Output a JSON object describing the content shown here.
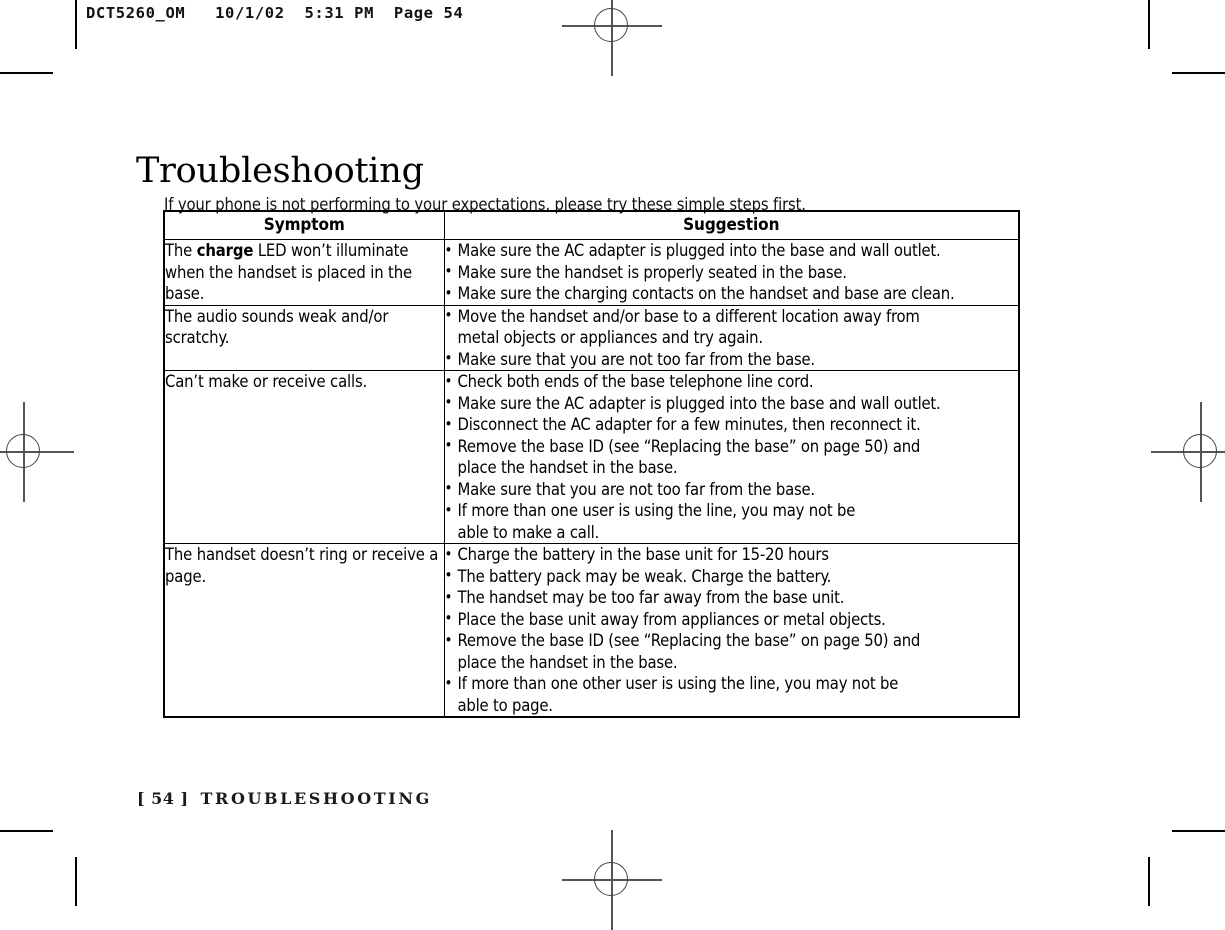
{
  "slug": "DCT5260_OM   10/1/02  5:31 PM  Page 54",
  "title": "Troubleshooting",
  "intro": "If your phone is not performing to your expectations, please try these simple steps first.",
  "table": {
    "headers": {
      "symptom": "Symptom",
      "suggestion": "Suggestion"
    },
    "rows": [
      {
        "symptom_pre": "The ",
        "symptom_bold": "charge",
        "symptom_post": " LED won’t illuminate when the handset is placed in the base.",
        "suggestions": [
          {
            "text": "Make sure the AC adapter is plugged into the base and wall outlet.",
            "cont": ""
          },
          {
            "text": "Make sure the handset is properly seated in the base.",
            "cont": ""
          },
          {
            "text": "Make sure the charging contacts on the handset and base are clean.",
            "cont": ""
          }
        ]
      },
      {
        "symptom": "The audio sounds weak and/or scratchy.",
        "suggestions": [
          {
            "text": "Move the handset and/or base to a different location away from",
            "cont": "metal objects or appliances and try again."
          },
          {
            "text": "Make sure that you are not too far from the base.",
            "cont": ""
          }
        ]
      },
      {
        "symptom": "Can’t make or receive calls.",
        "suggestions": [
          {
            "text": "Check both ends of the base telephone line cord.",
            "cont": ""
          },
          {
            "text": "Make sure the AC adapter is plugged into the base and wall outlet.",
            "cont": ""
          },
          {
            "text": "Disconnect the AC adapter for a few minutes, then reconnect it.",
            "cont": ""
          },
          {
            "text": "Remove the base ID (see “Replacing the base” on page 50) and",
            "cont": "place the handset in the base."
          },
          {
            "text": "Make sure that you are not too far from the base.",
            "cont": ""
          },
          {
            "text": "If more than one user is using the line, you may not be",
            "cont": "able to make a call."
          }
        ]
      },
      {
        "symptom": "The handset doesn’t ring or receive a page.",
        "suggestions": [
          {
            "text": "Charge the battery in the base unit for 15-20 hours",
            "cont": ""
          },
          {
            "text": "The battery pack may be weak. Charge the battery.",
            "cont": ""
          },
          {
            "text": "The handset may be too far away from the base unit.",
            "cont": ""
          },
          {
            "text": "Place the base unit away from appliances or metal objects.",
            "cont": ""
          },
          {
            "text": "Remove the base ID (see “Replacing the base” on page 50) and",
            "cont": "place the handset in the base."
          },
          {
            "text": "If more than one other user is using the line, you may not be",
            "cont": "able to page."
          }
        ]
      }
    ]
  },
  "footer": {
    "folio": "[ 54 ]",
    "chapter": "TROUBLESHOOTING"
  }
}
